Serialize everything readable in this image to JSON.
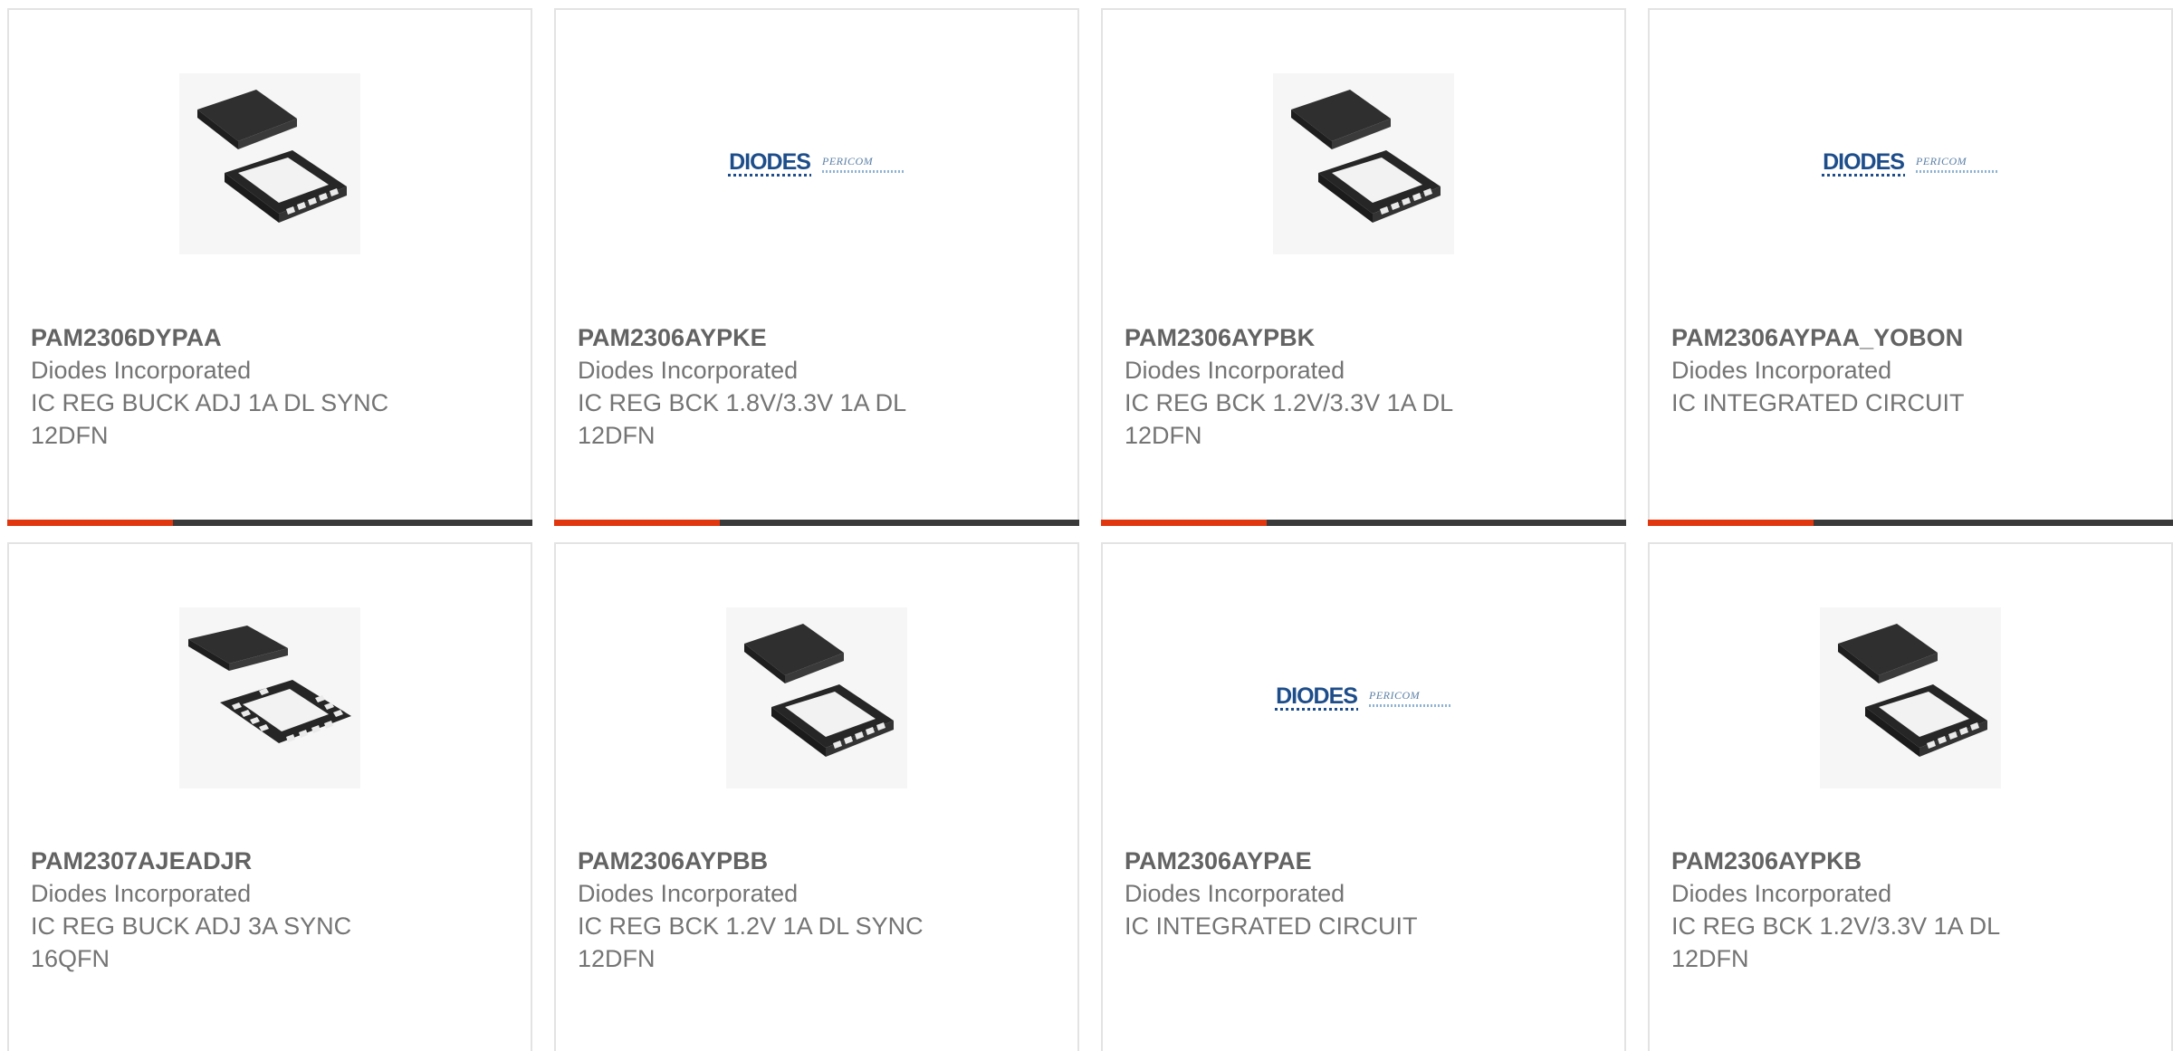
{
  "products": [
    {
      "part_number": "PAM2306DYPAA",
      "manufacturer": "Diodes Incorporated",
      "description": "IC REG BUCK ADJ 1A DL SYNC 12DFN",
      "image": "dfn12-chip-image"
    },
    {
      "part_number": "PAM2306AYPKE",
      "manufacturer": "Diodes Incorporated",
      "description": "IC REG BCK 1.8V/3.3V 1A DL 12DFN",
      "image": "diodes-pericom-logo"
    },
    {
      "part_number": "PAM2306AYPBK",
      "manufacturer": "Diodes Incorporated",
      "description": "IC REG BCK 1.2V/3.3V 1A DL 12DFN",
      "image": "dfn12-chip-image"
    },
    {
      "part_number": "PAM2306AYPAA_YOBON",
      "manufacturer": "Diodes Incorporated",
      "description": "IC INTEGRATED CIRCUIT",
      "image": "diodes-pericom-logo"
    },
    {
      "part_number": "PAM2307AJEADJR",
      "manufacturer": "Diodes Incorporated",
      "description": "IC REG BUCK ADJ 3A SYNC 16QFN",
      "image": "qfn16-chip-image"
    },
    {
      "part_number": "PAM2306AYPBB",
      "manufacturer": "Diodes Incorporated",
      "description": "IC REG BCK 1.2V 1A DL SYNC 12DFN",
      "image": "dfn12-chip-image"
    },
    {
      "part_number": "PAM2306AYPAE",
      "manufacturer": "Diodes Incorporated",
      "description": "IC INTEGRATED CIRCUIT",
      "image": "diodes-pericom-logo"
    },
    {
      "part_number": "PAM2306AYPKB",
      "manufacturer": "Diodes Incorporated",
      "description": "IC REG BCK 1.2V/3.3V 1A DL 12DFN",
      "image": "dfn12-chip-image"
    }
  ],
  "logo": {
    "brand": "DIODES",
    "secondary": "PERICOM"
  },
  "colors": {
    "accent": "#e0370f",
    "bar": "#3a3a3a",
    "border": "#e3e3e3",
    "title_text": "#636363",
    "body_text": "#747474",
    "logo_blue": "#1d4d8a"
  }
}
